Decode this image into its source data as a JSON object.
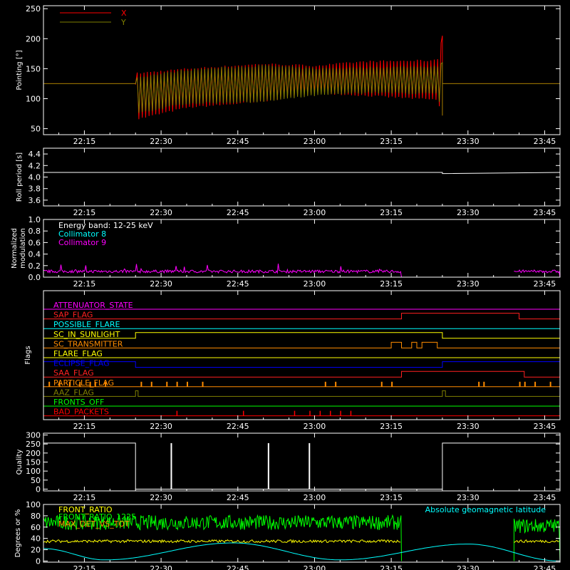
{
  "x_tick_labels": [
    "22:15",
    "22:30",
    "22:45",
    "23:00",
    "23:15",
    "23:30",
    "23:45"
  ],
  "panels": {
    "pointing": {
      "ylabel": "Pointing [°]",
      "yticks": [
        "50",
        "100",
        "150",
        "200",
        "250"
      ],
      "legend": [
        {
          "label": "X",
          "color": "#ff0000"
        },
        {
          "label": "Y",
          "color": "#808000"
        }
      ]
    },
    "roll": {
      "ylabel": "Roll period [s]",
      "yticks": [
        "3.6",
        "3.8",
        "4.0",
        "4.2",
        "4.4"
      ]
    },
    "modulation": {
      "ylabel_line1": "Normalized",
      "ylabel_line2": "modulation",
      "yticks": [
        "0.0",
        "0.2",
        "0.4",
        "0.6",
        "0.8",
        "1.0"
      ],
      "legend": [
        {
          "label": "Energy band: 12-25 keV",
          "color": "#ffffff"
        },
        {
          "label": "Collimator 8",
          "color": "#00ffff"
        },
        {
          "label": "Collimator 9",
          "color": "#ff00ff"
        }
      ]
    },
    "flags": {
      "ylabel": "Flags",
      "items": [
        {
          "label": "ATTENUATOR_STATE",
          "color": "#ff00ff"
        },
        {
          "label": "SAP_FLAG",
          "color": "#ff2020"
        },
        {
          "label": "POSSIBLE_FLARE",
          "color": "#00ffff"
        },
        {
          "label": "SC_IN_SUNLIGHT",
          "color": "#ffff00"
        },
        {
          "label": "SC_TRANSMITTER",
          "color": "#ff8c00"
        },
        {
          "label": "FLARE_FLAG",
          "color": "#ffff00"
        },
        {
          "label": "ECLIPSE_FLAG",
          "color": "#0000ff"
        },
        {
          "label": "SAA_FLAG",
          "color": "#ff2020"
        },
        {
          "label": "PARTICLE_FLAG",
          "color": "#ff8c00"
        },
        {
          "label": "AAZ_FLAG",
          "color": "#808000"
        },
        {
          "label": "FRONTS_OFF",
          "color": "#00ff00"
        },
        {
          "label": "BAD_PACKETS",
          "color": "#ff0000"
        }
      ]
    },
    "quality": {
      "ylabel": "Quality",
      "yticks": [
        "0",
        "50",
        "100",
        "150",
        "200",
        "250",
        "300"
      ]
    },
    "geo": {
      "ylabel": "Degrees or %",
      "yticks": [
        "0",
        "20",
        "40",
        "60",
        "80",
        "100"
      ],
      "legend": [
        {
          "label": "FRONT_RATIO",
          "color": "#ffff00"
        },
        {
          "label": "FRONT_RATIO_1225",
          "color": "#00ff00"
        },
        {
          "label": "MAX_DET_VS_TOT",
          "color": "#ff8c00"
        }
      ],
      "right_label": {
        "label": "Absolute geomagnetic latitude",
        "color": "#00ffff"
      }
    }
  },
  "chart_data": [
    {
      "type": "line",
      "xlabel": "",
      "ylabel": "Pointing [°]",
      "ylim": [
        40,
        255
      ],
      "x_range": [
        "22:07",
        "23:48"
      ],
      "series": [
        {
          "name": "X",
          "color": "#ff0000",
          "x": [
            "22:07",
            "22:25",
            "22:25",
            "22:35",
            "22:50",
            "23:00",
            "23:10",
            "23:24",
            "23:25",
            "23:25",
            "23:48"
          ],
          "upper": [
            125,
            125,
            142,
            150,
            158,
            155,
            162,
            164,
            205,
            125,
            125
          ],
          "lower": [
            125,
            125,
            65,
            85,
            95,
            110,
            105,
            98,
            72,
            125,
            125
          ]
        },
        {
          "name": "Y",
          "color": "#808000",
          "x": [
            "22:07",
            "22:25",
            "22:25",
            "22:35",
            "22:50",
            "23:00",
            "23:10",
            "23:24",
            "23:25",
            "23:25",
            "23:48"
          ],
          "upper": [
            125,
            125,
            135,
            148,
            155,
            150,
            152,
            154,
            160,
            125,
            125
          ],
          "lower": [
            125,
            125,
            75,
            92,
            95,
            105,
            110,
            108,
            72,
            125,
            125
          ]
        }
      ]
    },
    {
      "type": "line",
      "ylabel": "Roll period [s]",
      "ylim": [
        3.5,
        4.5
      ],
      "series": [
        {
          "name": "",
          "x": [
            "22:07",
            "23:25",
            "23:25",
            "23:48"
          ],
          "values": [
            4.08,
            4.08,
            4.06,
            4.08
          ],
          "color": "#ffffff"
        }
      ]
    },
    {
      "type": "line",
      "ylabel": "Normalized modulation",
      "ylim": [
        0.0,
        1.0
      ],
      "series": [
        {
          "name": "Collimator 8",
          "color": "#00ffff",
          "x": [
            "22:07",
            "23:48"
          ],
          "values": [
            0.0,
            0.0
          ]
        },
        {
          "name": "Collimator 9",
          "color": "#ff00ff",
          "segments": [
            {
              "x": [
                "22:07",
                "23:17"
              ],
              "mean": 0.1,
              "max_spike": 0.25
            },
            {
              "x": [
                "23:39",
                "23:48"
              ],
              "mean": 0.1,
              "max_spike": 0.18
            }
          ]
        }
      ]
    },
    {
      "type": "line",
      "ylabel": "Quality",
      "ylim": [
        0,
        300
      ],
      "series": [
        {
          "name": "",
          "color": "#ffffff",
          "x": [
            "22:07",
            "22:25",
            "22:25",
            "23:25",
            "23:25",
            "23:48"
          ],
          "values": [
            255,
            255,
            0,
            0,
            255,
            255
          ],
          "spikes": [
            {
              "x": "22:32",
              "value": 255
            },
            {
              "x": "22:51",
              "value": 255
            },
            {
              "x": "22:59",
              "value": 255
            }
          ]
        }
      ]
    },
    {
      "type": "line",
      "ylabel": "Degrees or %",
      "ylim": [
        0,
        100
      ],
      "series": [
        {
          "name": "FRONT_RATIO",
          "color": "#ffff00",
          "segments": [
            {
              "x": [
                "22:07",
                "23:17"
              ],
              "mean": 35
            },
            {
              "x": [
                "23:39",
                "23:48"
              ],
              "mean": 35
            }
          ]
        },
        {
          "name": "FRONT_RATIO_1225",
          "color": "#00ff00",
          "segments": [
            {
              "x": [
                "22:07",
                "23:17"
              ],
              "mean": 68
            },
            {
              "x": [
                "23:39",
                "23:48"
              ],
              "mean": 62
            }
          ]
        },
        {
          "name": "Absolute geomagnetic latitude",
          "color": "#00ffff",
          "x": [
            "22:07",
            "22:19",
            "22:44",
            "23:05",
            "23:30",
            "23:48"
          ],
          "values": [
            22,
            2,
            32,
            2,
            30,
            0
          ]
        }
      ]
    }
  ]
}
